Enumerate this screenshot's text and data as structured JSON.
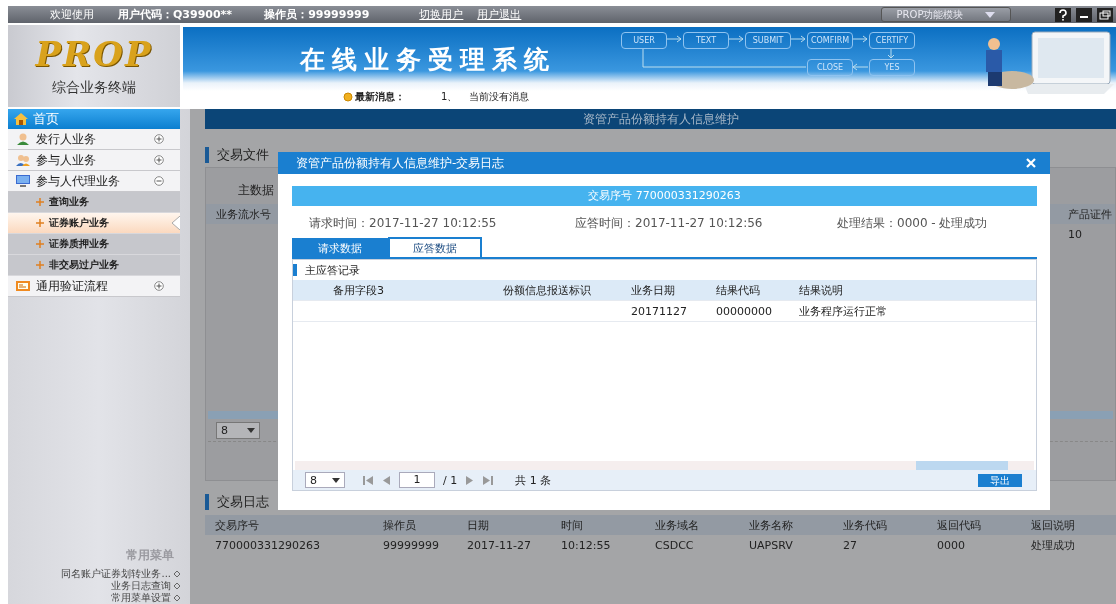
{
  "top_bar": {
    "welcome": "欢迎使用",
    "user_code": "用户代码：Q39900**",
    "operator": "操作员：99999999",
    "links": [
      "切换用户",
      "用户退出"
    ],
    "module_select": "PROP功能模块"
  },
  "logo": {
    "text": "PROP",
    "subtitle": "综合业务终端"
  },
  "banner": {
    "title": "在线业务受理系统",
    "flow_steps": [
      "USER",
      "TEXT",
      "SUBMIT",
      "COMFIRM",
      "CERTIFY",
      "CLOSE",
      "YES"
    ],
    "news_label": "最新消息：",
    "news_index": "1、",
    "news_text": "当前没有消息"
  },
  "sidebar": {
    "home": "首页",
    "items": [
      {
        "label": "发行人业务",
        "expanded": false
      },
      {
        "label": "参与人业务",
        "expanded": false
      },
      {
        "label": "参与人代理业务",
        "expanded": true,
        "children": [
          {
            "label": "查询业务",
            "selected": false
          },
          {
            "label": "证券账户业务",
            "selected": true
          },
          {
            "label": "证券质押业务",
            "selected": false
          },
          {
            "label": "非交易过户业务",
            "selected": false
          }
        ]
      },
      {
        "label": "通用验证流程",
        "expanded": false
      }
    ],
    "favorites_title": "常用菜单",
    "favorites": [
      "同名账户证券划转业务...",
      "业务日志查询",
      "常用菜单设置"
    ]
  },
  "main": {
    "page_title": "资管产品份额持有人信息维护",
    "file_section": {
      "title": "交易文件",
      "subtitle": "主数据",
      "columns": [
        "业务流水号",
        "产品证件"
      ],
      "rows": [
        [
          "",
          "10"
        ]
      ],
      "page_size": "8"
    },
    "log_section": {
      "title": "交易日志",
      "columns": [
        "交易序号",
        "操作员",
        "日期",
        "时间",
        "业务域名",
        "业务名称",
        "业务代码",
        "返回代码",
        "返回说明"
      ],
      "rows": [
        [
          "770000331290263",
          "99999999",
          "2017-11-27",
          "10:12:55",
          "CSDCC",
          "UAPSRV",
          "27",
          "0000",
          "处理成功"
        ]
      ]
    }
  },
  "dialog": {
    "title": "资管产品份额持有人信息维护-交易日志",
    "serial": "交易序号 770000331290263",
    "request_time": "请求时间：2017-11-27 10:12:55",
    "response_time": "应答时间：2017-11-27 10:12:56",
    "result": "处理结果：0000 - 处理成功",
    "tabs": [
      {
        "label": "请求数据",
        "selected": false
      },
      {
        "label": "应答数据",
        "selected": true
      }
    ],
    "panel_title": "主应答记录",
    "columns": [
      "",
      "备用字段3",
      "份额信息报送标识",
      "业务日期",
      "结果代码",
      "结果说明"
    ],
    "rows": [
      [
        "",
        "",
        "",
        "20171127",
        "00000000",
        "业务程序运行正常"
      ]
    ],
    "pager": {
      "page_size": "8",
      "page": "1",
      "pages": "/ 1",
      "total": "共 1 条"
    },
    "export": "导出"
  }
}
